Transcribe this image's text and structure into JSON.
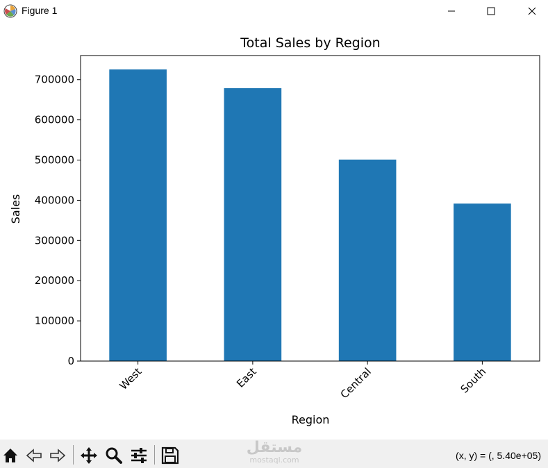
{
  "window": {
    "title": "Figure 1",
    "icons": [
      "matplotlib-icon",
      "minimize-icon",
      "maximize-icon",
      "close-icon"
    ]
  },
  "chart_data": {
    "type": "bar",
    "title": "Total Sales by Region",
    "xlabel": "Region",
    "ylabel": "Sales",
    "categories": [
      "West",
      "East",
      "Central",
      "South"
    ],
    "values": [
      725458,
      678781,
      501240,
      391722
    ],
    "ylim": [
      0,
      760000
    ],
    "yticks": [
      0,
      100000,
      200000,
      300000,
      400000,
      500000,
      600000,
      700000
    ],
    "ytick_labels": [
      "0",
      "100000",
      "200000",
      "300000",
      "400000",
      "500000",
      "600000",
      "700000"
    ],
    "bar_color": "#1f77b4",
    "grid": false,
    "legend": "none"
  },
  "toolbar": {
    "icons": [
      "home-icon",
      "back-icon",
      "forward-icon",
      "pan-icon",
      "zoom-icon",
      "configure-subplots-icon",
      "save-icon"
    ],
    "coords_text": "(x, y) = (, 5.40e+05)"
  },
  "watermark": {
    "main": "مستقل",
    "sub": "mostaql.com"
  }
}
